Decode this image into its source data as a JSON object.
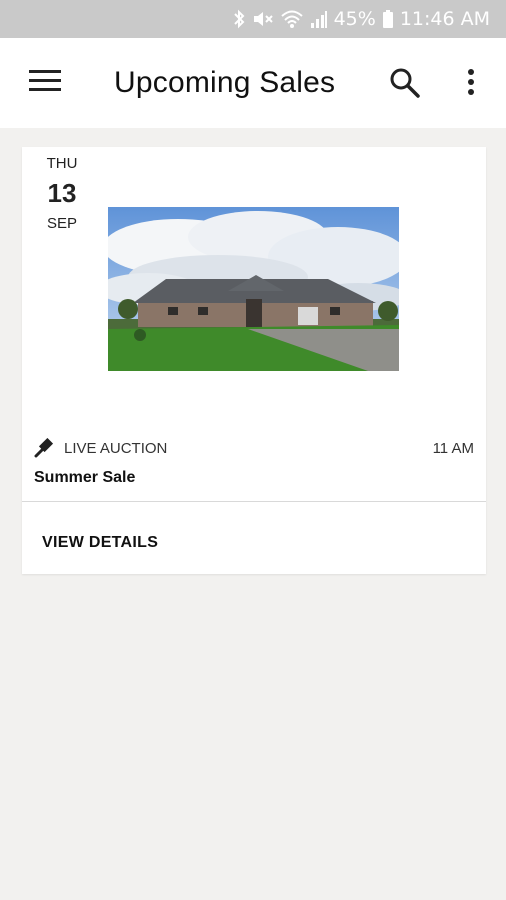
{
  "status_bar": {
    "battery": "45%",
    "time": "11:46 AM",
    "icons": [
      "bluetooth-icon",
      "mute-icon",
      "wifi-icon",
      "signal-icon",
      "battery-icon"
    ]
  },
  "app_bar": {
    "title": "Upcoming Sales",
    "icons": [
      "menu-icon",
      "search-icon",
      "more-vert-icon"
    ]
  },
  "sales": [
    {
      "date": {
        "dow": "THU",
        "day": "13",
        "month": "SEP"
      },
      "type": "LIVE AUCTION",
      "type_icon": "gavel-icon",
      "time": "11 AM",
      "name": "Summer Sale",
      "action": "VIEW DETAILS"
    }
  ],
  "colors": {
    "background": "#f2f1ef",
    "status_bar": "#c9c9c9",
    "card": "#ffffff"
  }
}
